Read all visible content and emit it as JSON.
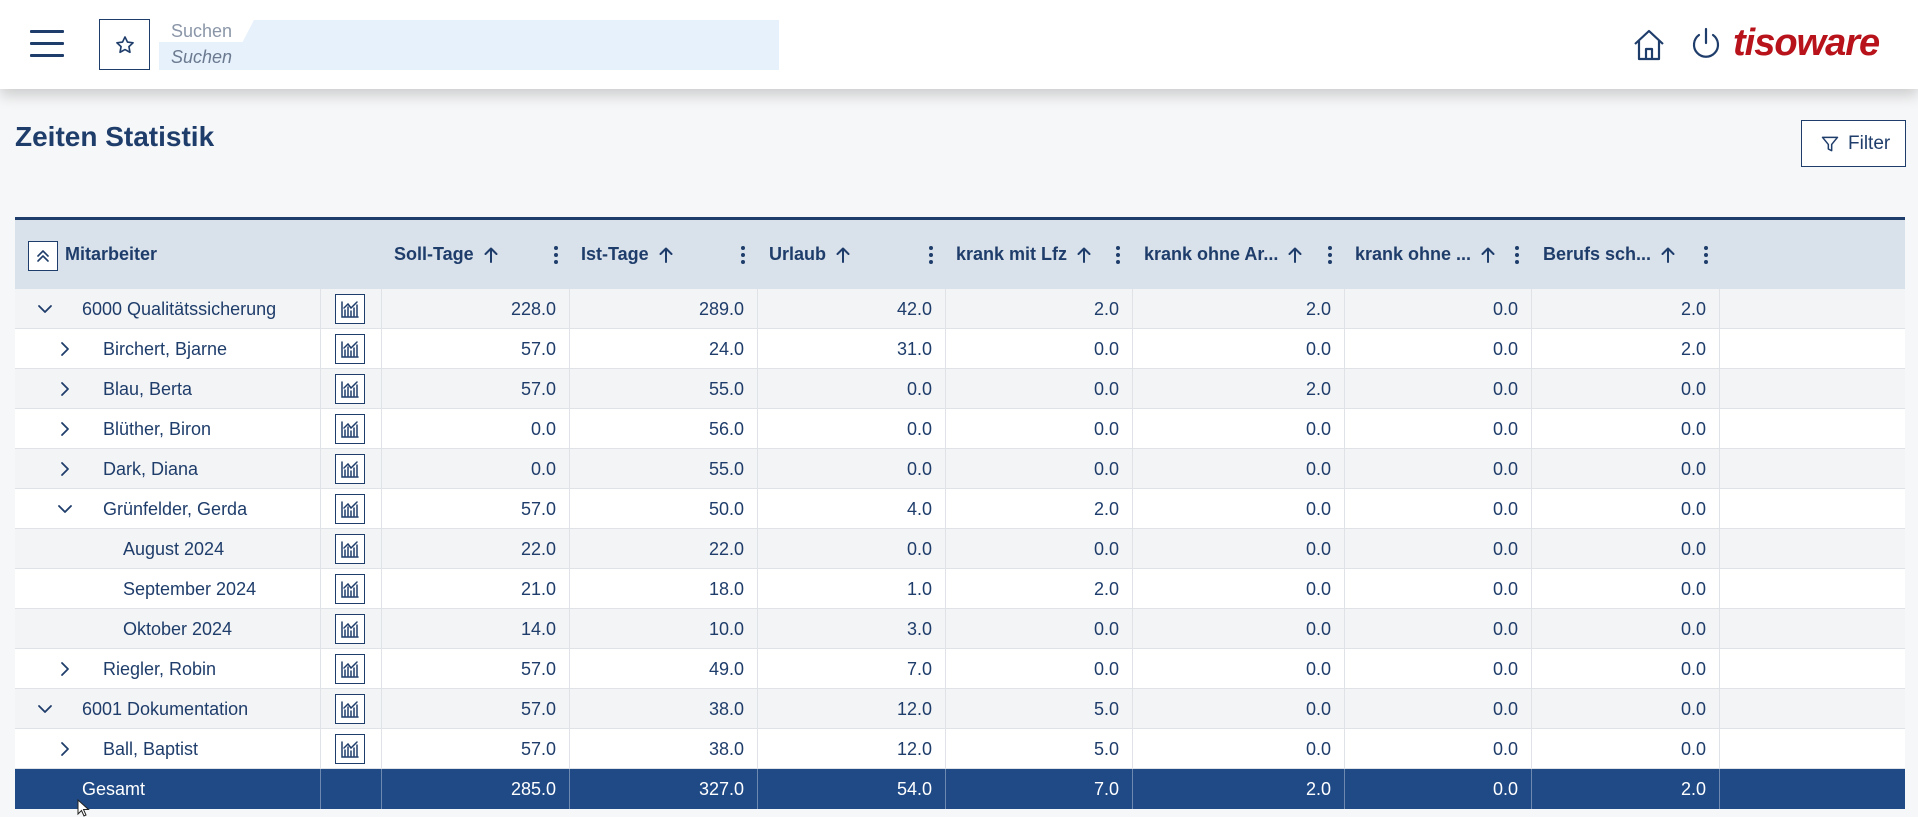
{
  "header": {
    "search_label": "Suchen",
    "search_placeholder": "Suchen",
    "logo_text": "tisoware"
  },
  "page": {
    "title": "Zeiten Statistik",
    "filter_label": "Filter"
  },
  "table": {
    "columns": [
      "Mitarbeiter",
      "Soll-Tage",
      "Ist-Tage",
      "Urlaub",
      "krank mit Lfz",
      "krank ohne Ar...",
      "krank ohne ...",
      "Berufs sch..."
    ],
    "rows": [
      {
        "level": 0,
        "toggle": "expanded",
        "name": "6000 Qualitätssicherung",
        "values": [
          "228.0",
          "289.0",
          "42.0",
          "2.0",
          "2.0",
          "0.0",
          "2.0"
        ]
      },
      {
        "level": 1,
        "toggle": "collapsed",
        "name": "Birchert, Bjarne",
        "values": [
          "57.0",
          "24.0",
          "31.0",
          "0.0",
          "0.0",
          "0.0",
          "2.0"
        ]
      },
      {
        "level": 1,
        "toggle": "collapsed",
        "name": "Blau, Berta",
        "values": [
          "57.0",
          "55.0",
          "0.0",
          "0.0",
          "2.0",
          "0.0",
          "0.0"
        ]
      },
      {
        "level": 1,
        "toggle": "collapsed",
        "name": "Blüther, Biron",
        "values": [
          "0.0",
          "56.0",
          "0.0",
          "0.0",
          "0.0",
          "0.0",
          "0.0"
        ]
      },
      {
        "level": 1,
        "toggle": "collapsed",
        "name": "Dark, Diana",
        "values": [
          "0.0",
          "55.0",
          "0.0",
          "0.0",
          "0.0",
          "0.0",
          "0.0"
        ]
      },
      {
        "level": 1,
        "toggle": "expanded",
        "name": "Grünfelder, Gerda",
        "values": [
          "57.0",
          "50.0",
          "4.0",
          "2.0",
          "0.0",
          "0.0",
          "0.0"
        ]
      },
      {
        "level": 2,
        "toggle": "none",
        "name": "August 2024",
        "values": [
          "22.0",
          "22.0",
          "0.0",
          "0.0",
          "0.0",
          "0.0",
          "0.0"
        ]
      },
      {
        "level": 2,
        "toggle": "none",
        "name": "September 2024",
        "values": [
          "21.0",
          "18.0",
          "1.0",
          "2.0",
          "0.0",
          "0.0",
          "0.0"
        ]
      },
      {
        "level": 2,
        "toggle": "none",
        "name": "Oktober 2024",
        "values": [
          "14.0",
          "10.0",
          "3.0",
          "0.0",
          "0.0",
          "0.0",
          "0.0"
        ]
      },
      {
        "level": 1,
        "toggle": "collapsed",
        "name": "Riegler, Robin",
        "values": [
          "57.0",
          "49.0",
          "7.0",
          "0.0",
          "0.0",
          "0.0",
          "0.0"
        ]
      },
      {
        "level": 0,
        "toggle": "expanded",
        "name": "6001 Dokumentation",
        "values": [
          "57.0",
          "38.0",
          "12.0",
          "5.0",
          "0.0",
          "0.0",
          "0.0"
        ]
      },
      {
        "level": 1,
        "toggle": "collapsed",
        "name": "Ball, Baptist",
        "values": [
          "57.0",
          "38.0",
          "12.0",
          "5.0",
          "0.0",
          "0.0",
          "0.0"
        ]
      }
    ],
    "total": {
      "label": "Gesamt",
      "values": [
        "285.0",
        "327.0",
        "54.0",
        "7.0",
        "2.0",
        "0.0",
        "2.0"
      ]
    }
  },
  "colors": {
    "brand_navy": "#1f3d6b",
    "total_row": "#1f4a86",
    "logo_red": "#b8121b",
    "header_row": "#d9e1ea"
  },
  "icons": [
    "menu-icon",
    "star-icon",
    "home-icon",
    "power-icon",
    "filter-icon",
    "collapse-all-icon",
    "sort-arrow-icon",
    "more-vert-icon",
    "chevron-down-icon",
    "chevron-right-icon",
    "chart-icon",
    "cursor-icon"
  ]
}
